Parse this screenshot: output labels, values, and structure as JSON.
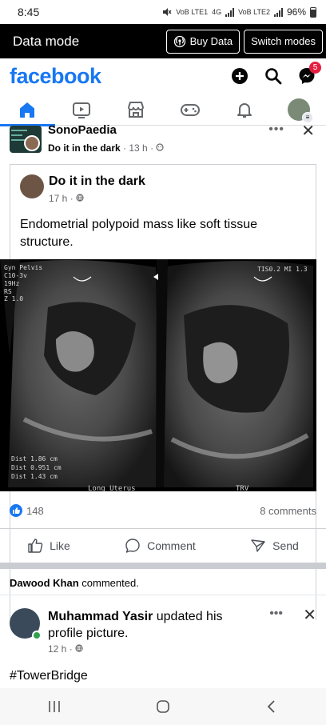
{
  "status": {
    "time": "8:45",
    "sim1": "VoB LTE1",
    "sim1_tech": "4G",
    "sim2": "VoB LTE2",
    "battery": "96%"
  },
  "data_mode": {
    "title": "Data mode",
    "buy_label": "Buy Data",
    "switch_label": "Switch modes"
  },
  "header": {
    "logo": "facebook",
    "messenger_badge": "5"
  },
  "tabs": [
    {
      "icon": "home-icon",
      "active": true
    },
    {
      "icon": "video-icon"
    },
    {
      "icon": "marketplace-icon"
    },
    {
      "icon": "gaming-icon"
    },
    {
      "icon": "bell-icon"
    },
    {
      "icon": "profile-menu-icon"
    }
  ],
  "post": {
    "group_name": "SonoPaedia",
    "sharer": "Do it in the dark",
    "time": "13 h",
    "shared": {
      "author": "Do it in the dark",
      "time": "17 h",
      "text": "Endometrial polypoid  mass like soft tissue structure."
    },
    "image_labels": {
      "mode": "Gyn Pelvis",
      "probe": "C10-3v",
      "freq": "19Hz",
      "rs": "RS",
      "z": "Z 1.0",
      "index": "TIS0.2  MI 1.3",
      "dist1": "Dist  1.86 cm",
      "dist2": "Dist  0.951 cm",
      "dist3": "Dist  1.43 cm",
      "caption_left": "Long Uterus",
      "caption_right": "TRV"
    },
    "likes": "148",
    "comments": "8 comments",
    "actions": {
      "like": "Like",
      "comment": "Comment",
      "send": "Send"
    }
  },
  "notice": {
    "name": "Dawood Khan",
    "action": " commented."
  },
  "post2": {
    "name": "Muhammad Yasir",
    "action": " updated his profile picture.",
    "time": "12 h",
    "text": "#TowerBridge"
  },
  "colors": {
    "brand": "#1877f2",
    "badge": "#e41e3f",
    "online": "#31a24c"
  }
}
